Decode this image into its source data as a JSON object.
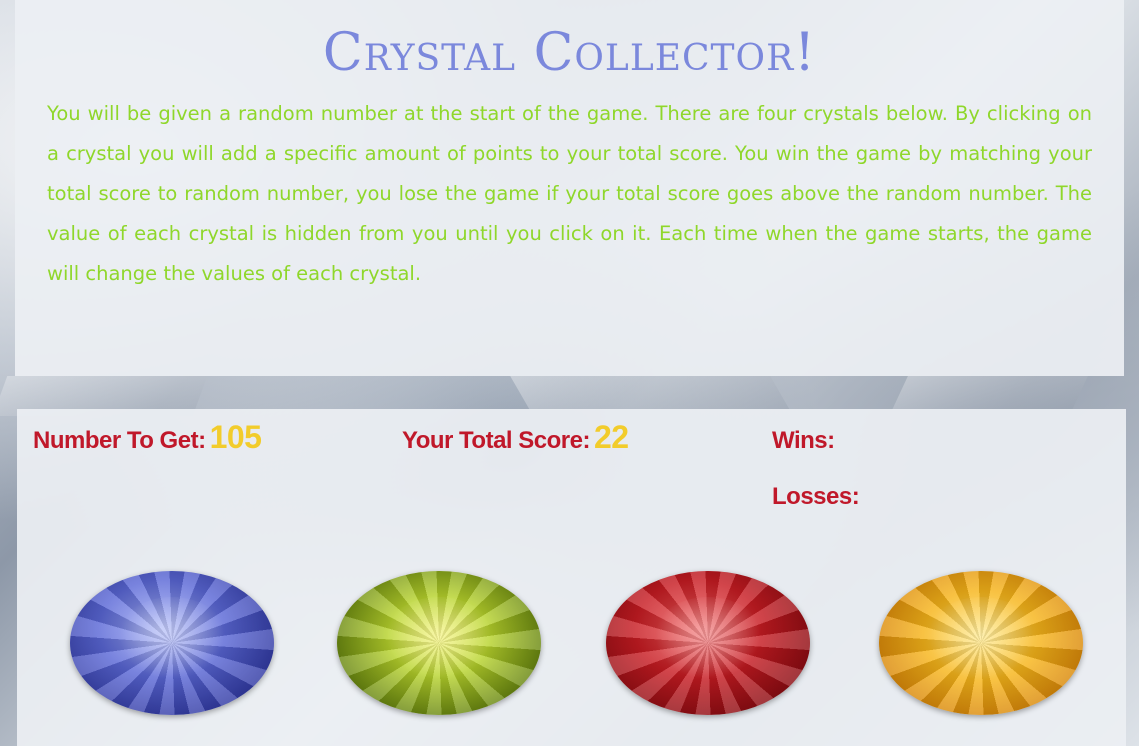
{
  "header": {
    "title": "Crystal Collector!",
    "instructions": "You will be given a random number at the start of the game. There are four crystals below. By clicking on a crystal you will add a specific amount of points to your total score. You win the game by matching your total score to random number, you lose the game if your total score goes above the random number. The value of each crystal is hidden from you until you click on it. Each time when the game starts, the game will change the values of each crystal."
  },
  "stats": {
    "target_label": "Number To Get:",
    "target_value": "105",
    "score_label": "Your Total Score:",
    "score_value": "22",
    "wins_label": "Wins:",
    "wins_value": "",
    "losses_label": "Losses:",
    "losses_value": ""
  },
  "crystals": [
    {
      "name": "blue-crystal",
      "color": "#5a67d6"
    },
    {
      "name": "green-crystal",
      "color": "#b8d42c"
    },
    {
      "name": "red-crystal",
      "color": "#c71b22"
    },
    {
      "name": "orange-crystal",
      "color": "#f7b51a"
    }
  ],
  "colors": {
    "title": "#7b88dc",
    "instructions": "#8fd72b",
    "stat_label": "#c0182a",
    "stat_value": "#f2cc2b"
  }
}
